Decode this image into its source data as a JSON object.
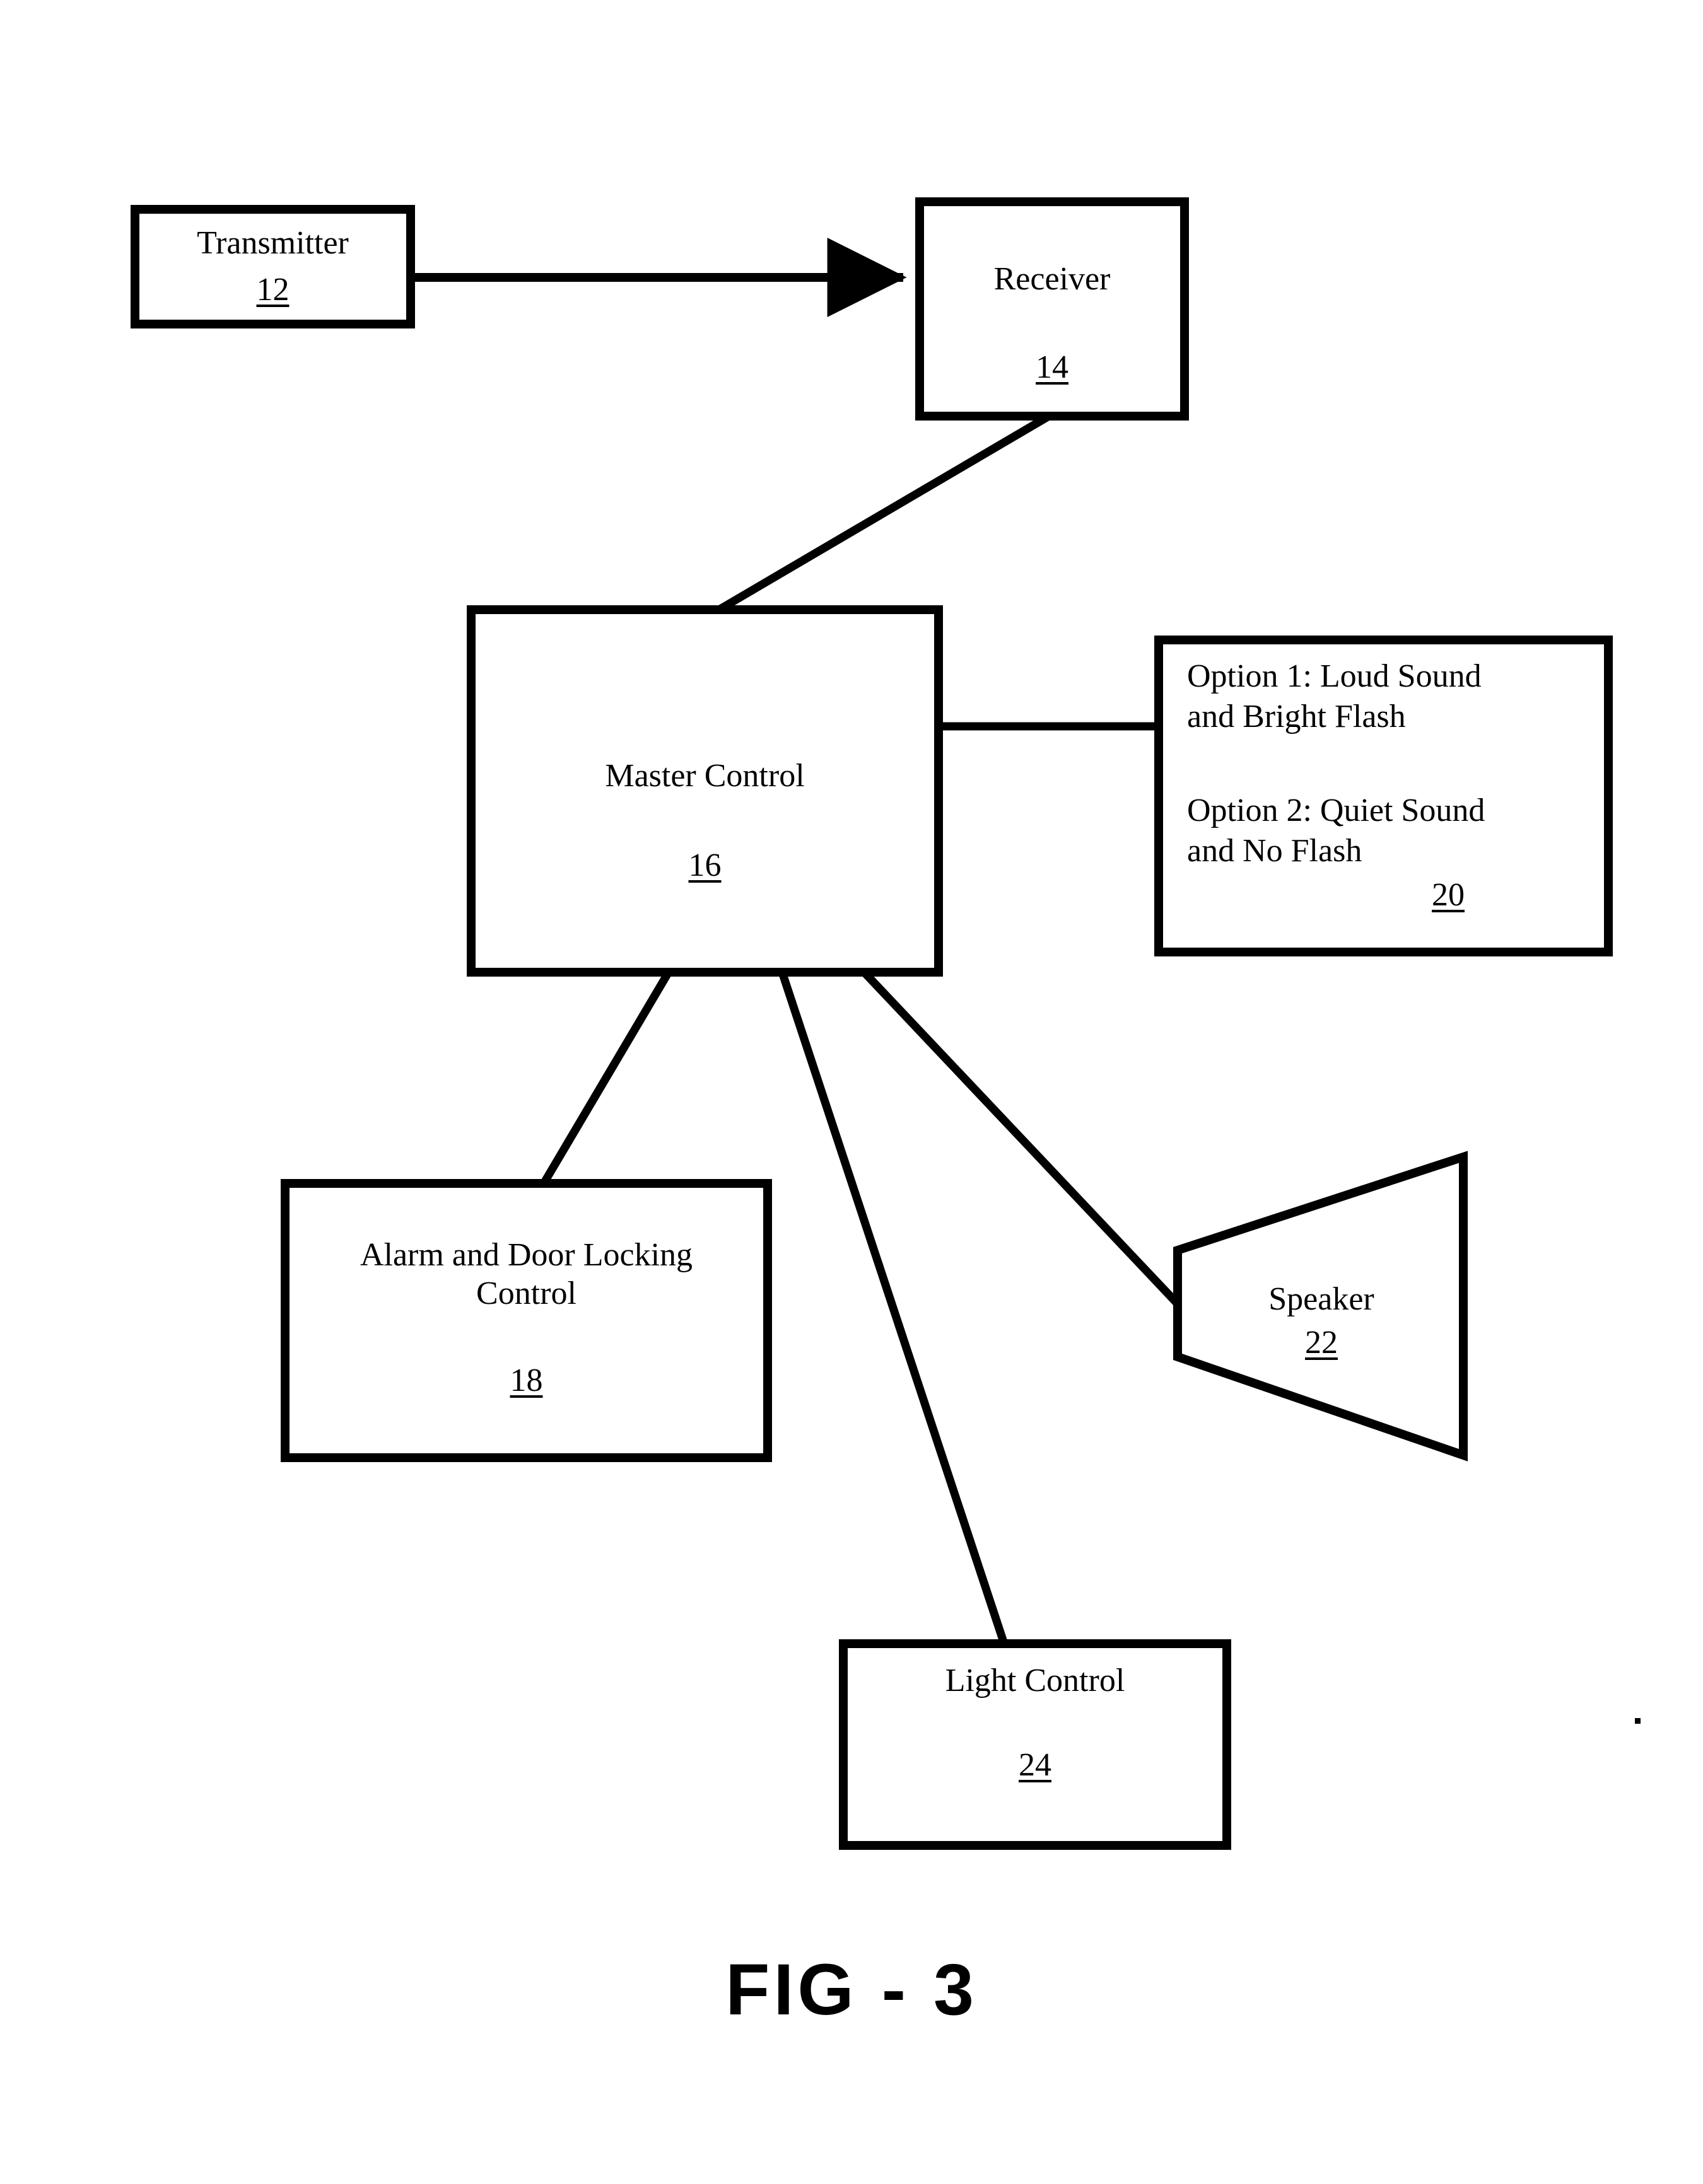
{
  "figure": {
    "caption": "FIG - 3",
    "ink_color": "#000000",
    "background_color": "#ffffff"
  },
  "nodes": {
    "transmitter": {
      "label": "Transmitter",
      "ref": "12",
      "shape": "rectangle"
    },
    "receiver": {
      "label": "Receiver",
      "ref": "14",
      "shape": "rectangle"
    },
    "master_control": {
      "label": "Master Control",
      "ref": "16",
      "shape": "rectangle"
    },
    "options": {
      "line1": "Option 1: Loud Sound",
      "line2": "and Bright Flash",
      "line3": "Option 2: Quiet Sound",
      "line4": "and No Flash",
      "ref": "20",
      "shape": "rectangle"
    },
    "alarm_door_locking_control": {
      "label": "Alarm and Door Locking\nControl",
      "ref": "18",
      "shape": "rectangle"
    },
    "speaker": {
      "label": "Speaker",
      "ref": "22",
      "shape": "trapezoid"
    },
    "light_control": {
      "label": "Light Control",
      "ref": "24",
      "shape": "rectangle"
    }
  },
  "connections": [
    {
      "from": "transmitter",
      "to": "receiver",
      "style": "arrow"
    },
    {
      "from": "receiver",
      "to": "master_control",
      "style": "line"
    },
    {
      "from": "master_control",
      "to": "options",
      "style": "line"
    },
    {
      "from": "master_control",
      "to": "alarm_door_locking_control",
      "style": "line"
    },
    {
      "from": "master_control",
      "to": "speaker",
      "style": "line"
    },
    {
      "from": "master_control",
      "to": "light_control",
      "style": "line"
    }
  ]
}
